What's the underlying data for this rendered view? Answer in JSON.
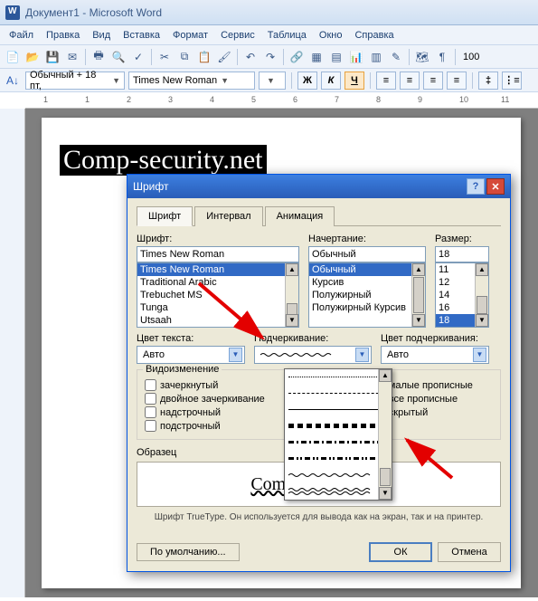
{
  "app": {
    "title": "Документ1 - Microsoft Word"
  },
  "menu": {
    "file": "Файл",
    "edit": "Правка",
    "view": "Вид",
    "insert": "Вставка",
    "format": "Формат",
    "tools": "Сервис",
    "table": "Таблица",
    "window": "Окно",
    "help": "Справка"
  },
  "format_bar": {
    "style": "Обычный + 18 пт,",
    "font": "Times New Roman",
    "zoom_or": "100",
    "bold": "Ж",
    "italic": "К",
    "underline": "Ч"
  },
  "document": {
    "selected_text": "Comp-security.net"
  },
  "dialog": {
    "title": "Шрифт",
    "tabs": {
      "font": "Шрифт",
      "spacing": "Интервал",
      "anim": "Анимация"
    },
    "labels": {
      "font": "Шрифт:",
      "style": "Начертание:",
      "size": "Размер:",
      "font_color": "Цвет текста:",
      "underline": "Подчеркивание:",
      "ul_color": "Цвет подчеркивания:",
      "effects": "Видоизменение",
      "sample": "Образец"
    },
    "font_value": "Times New Roman",
    "font_list": [
      "Times New Roman",
      "Traditional Arabic",
      "Trebuchet MS",
      "Tunga",
      "Utsaah"
    ],
    "style_value": "Обычный",
    "style_list": [
      "Обычный",
      "Курсив",
      "Полужирный",
      "Полужирный Курсив"
    ],
    "size_value": "18",
    "size_list": [
      "11",
      "12",
      "14",
      "16",
      "18"
    ],
    "color_auto": "Авто",
    "ul_color_auto": "Авто",
    "effects_left": {
      "strike": "зачеркнутый",
      "dstrike": "двойное зачеркивание",
      "super": "надстрочный",
      "sub": "подстрочный"
    },
    "effects_right": {
      "small": "малые прописные",
      "caps": "все прописные",
      "hidden": "скрытый"
    },
    "preview_text": "Comp-Security.net",
    "info": "Шрифт TrueType. Он используется для вывода как на экран, так и на принтер.",
    "buttons": {
      "default": "По умолчанию...",
      "ok": "ОК",
      "cancel": "Отмена"
    }
  }
}
